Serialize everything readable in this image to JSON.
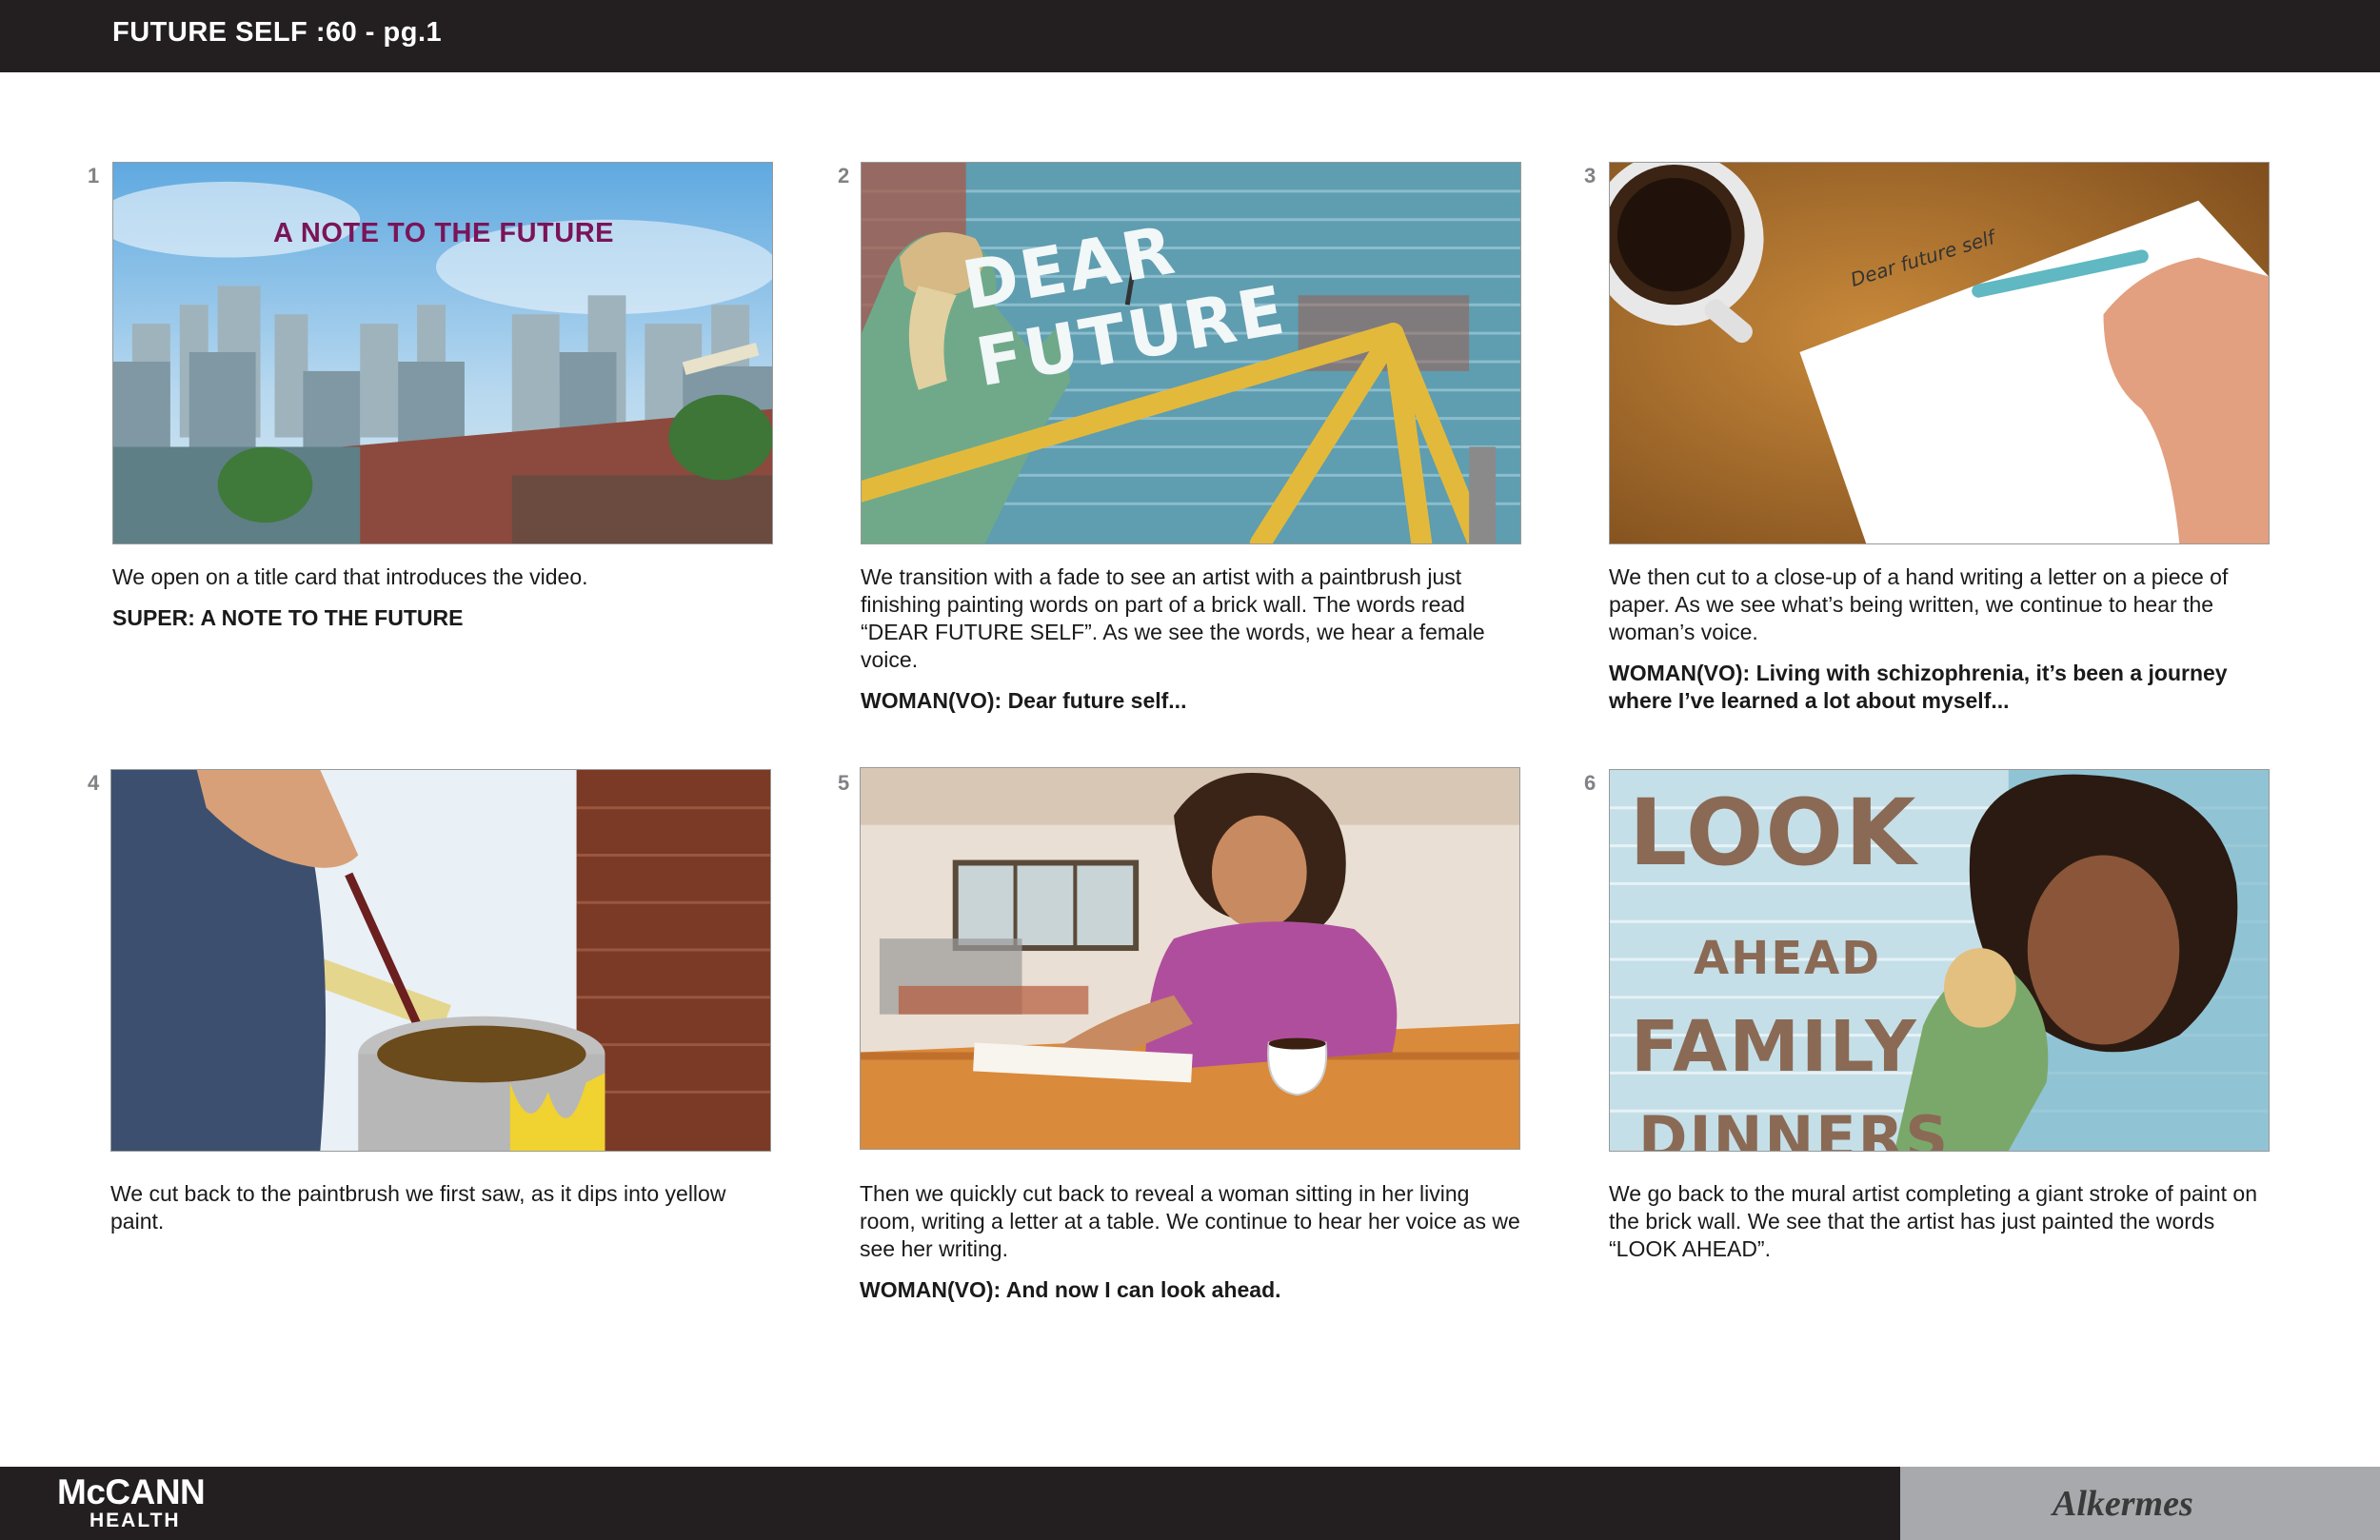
{
  "header": {
    "title": "FUTURE SELF :60 - pg.1"
  },
  "footer": {
    "agency_line1": "McCANN",
    "agency_line2": "HEALTH",
    "client": "Alkermes"
  },
  "panels": [
    {
      "number": "1",
      "description": "We open on a title card that introduces the video.",
      "vo": "SUPER: A NOTE TO THE FUTURE",
      "frame_text": "A NOTE TO THE FUTURE"
    },
    {
      "number": "2",
      "description": "We transition with a fade to see an artist with a paintbrush just finishing painting words on part of a brick wall. The words read “DEAR FUTURE SELF”. As we see the words, we hear a female voice.",
      "vo": "WOMAN(VO): Dear future self...",
      "frame_text": "DEAR FUTURE"
    },
    {
      "number": "3",
      "description": "We then cut to a close-up of a hand writing a letter on a piece of paper. As we see what’s being written, we continue to hear the woman’s voice.",
      "vo": "WOMAN(VO): Living with schizophrenia, it’s been a journey where I’ve learned a lot about myself...",
      "frame_text": "Dear future self"
    },
    {
      "number": "4",
      "description": "We cut back to the paintbrush we first saw, as it dips into yellow paint."
    },
    {
      "number": "5",
      "description": "Then we quickly cut back to reveal a woman sitting in her living room, writing a letter at a table. We continue to hear her voice as we see her writing.",
      "vo": "WOMAN(VO): And now I can look ahead."
    },
    {
      "number": "6",
      "description": "We go back to the mural artist completing a giant stroke of paint on the brick wall. We see that the artist has just painted the words “LOOK AHEAD”.",
      "frame_words": [
        "LOOK",
        "AHEAD",
        "FAMILY",
        "DINNERS"
      ]
    }
  ]
}
